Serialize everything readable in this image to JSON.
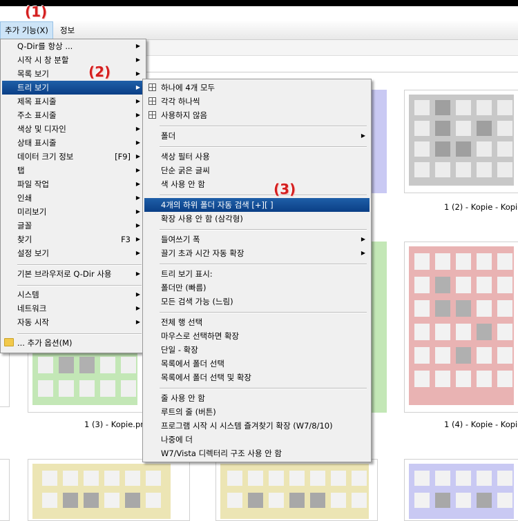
{
  "menubar": {
    "extra_label": "추가 기능(X)",
    "info_label": "정보"
  },
  "steps": {
    "s1": "(1)",
    "s2": "(2)",
    "s3": "(3)"
  },
  "thumbnails": {
    "captions": [
      "1 (2) - Kopie - Kopie.",
      "1 (3) - Kopie.png",
      "1 (4) - Kopie - Kopie."
    ],
    "colors": {
      "gray": "#c8c8c8",
      "green": "#c3e7b6",
      "red": "#e9b3b3",
      "yellow": "#ece5b4",
      "blue": "#b9b9ee",
      "lavender": "#c9c9f3"
    }
  },
  "main_menu": {
    "items": [
      {
        "label": "Q-Dir를 항상 ...",
        "arrow": "▶"
      },
      {
        "label": "시작 시 창 분할",
        "arrow": "▶"
      },
      {
        "label": "목록 보기",
        "arrow": "▶"
      },
      {
        "label": "트리 보기",
        "arrow": "▶"
      },
      {
        "label": "제목 표시줄",
        "arrow": "▶"
      },
      {
        "label": "주소 표시줄",
        "arrow": "▶"
      },
      {
        "label": "색상 및 디자인",
        "arrow": "▶"
      },
      {
        "label": "상태 표시줄",
        "arrow": "▶"
      },
      {
        "label": "데이터 크기 정보",
        "shortcut": "[F9]",
        "arrow": "▶"
      },
      {
        "label": "탭",
        "arrow": "▶"
      },
      {
        "label": "파일 작업",
        "arrow": "▶"
      },
      {
        "label": "인쇄",
        "arrow": "▶"
      },
      {
        "label": "미리보기",
        "arrow": "▶"
      },
      {
        "label": "글꼴",
        "arrow": "▶"
      },
      {
        "label": "찾기",
        "shortcut": "F3",
        "arrow": "▶"
      },
      {
        "label": "설정 보기",
        "arrow": "▶"
      },
      {
        "label": "기본 브라우저로 Q-Dir 사용",
        "arrow": "▶"
      },
      {
        "label": "시스템",
        "arrow": "▶"
      },
      {
        "label": "네트워크",
        "arrow": "▶"
      },
      {
        "label": "자동 시작",
        "arrow": "▶"
      },
      {
        "label": "... 추가 옵션(M)"
      }
    ]
  },
  "tree_menu": {
    "items": [
      {
        "label": "하나에 4개 모두",
        "icon": "grid-icon"
      },
      {
        "label": "각각 하나씩",
        "icon": "grid-icon"
      },
      {
        "label": "사용하지 않음",
        "icon": "grid-icon"
      },
      {
        "label": "폴더",
        "arrow": "▶"
      },
      {
        "label": "색상 필터 사용"
      },
      {
        "label": "단순 굵은 글씨"
      },
      {
        "label": "색 사용 안 함"
      },
      {
        "label": "4개의 하위 폴더 자동 검색 [+][ ]"
      },
      {
        "label": "확장 사용 안 함 (삼각형)"
      },
      {
        "label": "들여쓰기 폭",
        "arrow": "▶"
      },
      {
        "label": "끌기 초과 시간 자동 확장",
        "arrow": "▶"
      },
      {
        "label": "트리 보기 표시:"
      },
      {
        "label": "폴더만 (빠름)"
      },
      {
        "label": "모든 검색 가능 (느림)"
      },
      {
        "label": "전체 행 선택"
      },
      {
        "label": "마우스로 선택하면 확장"
      },
      {
        "label": "단일 - 확장"
      },
      {
        "label": "목록에서 폴더 선택"
      },
      {
        "label": "목록에서 폴더 선택 및 확장"
      },
      {
        "label": "줄 사용 안 함"
      },
      {
        "label": "루트의 줄 (버튼)"
      },
      {
        "label": "프로그램 시작 시 시스템 즐겨찾기 확장 (W7/8/10)"
      },
      {
        "label": "나중에 더"
      },
      {
        "label": "W7/Vista 디렉터리 구조 사용 안 함"
      }
    ]
  }
}
